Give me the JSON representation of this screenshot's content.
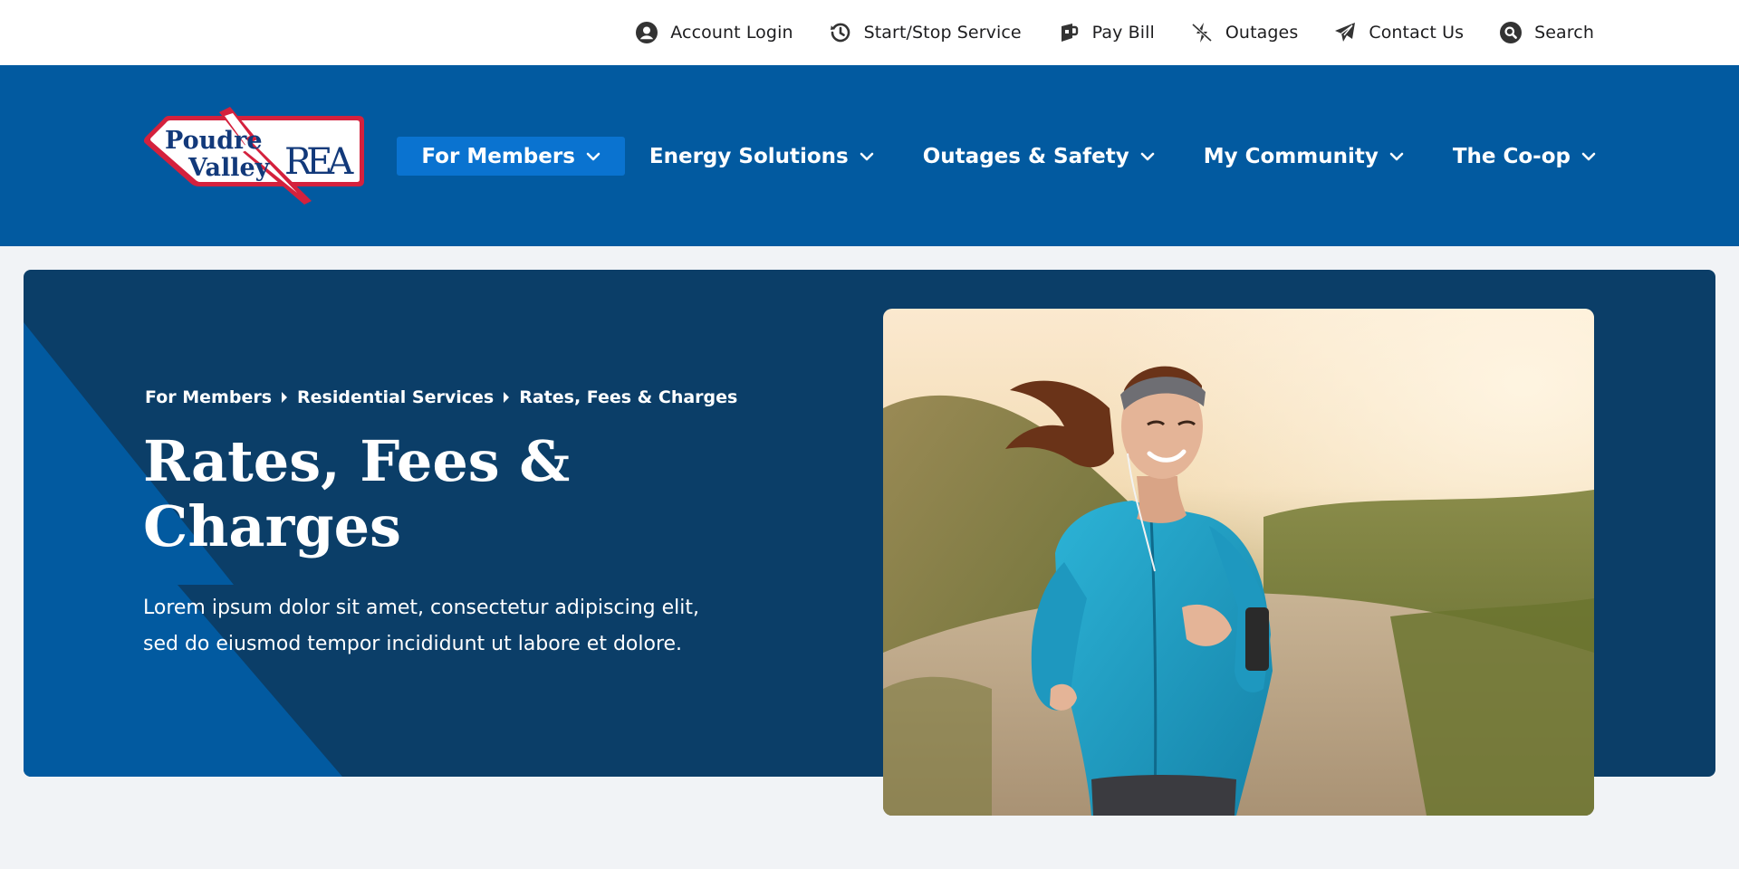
{
  "utility_bar": {
    "links": [
      {
        "label": "Account Login",
        "icon": "user-circle-icon"
      },
      {
        "label": "Start/Stop Service",
        "icon": "history-icon"
      },
      {
        "label": "Pay Bill",
        "icon": "bill-icon"
      },
      {
        "label": "Outages",
        "icon": "bolt-slash-icon"
      },
      {
        "label": "Contact Us",
        "icon": "paper-plane-icon"
      },
      {
        "label": "Search",
        "icon": "search-icon"
      }
    ]
  },
  "logo": {
    "line1": "Poudre",
    "line2": "Valley",
    "letters": "REA",
    "colors": {
      "red": "#d4213d",
      "navy": "#12397a"
    }
  },
  "primary_nav": {
    "items": [
      {
        "label": "For Members",
        "active": true
      },
      {
        "label": "Energy Solutions",
        "active": false
      },
      {
        "label": "Outages & Safety",
        "active": false
      },
      {
        "label": "My Community",
        "active": false
      },
      {
        "label": "The Co-op",
        "active": false
      }
    ]
  },
  "hero": {
    "breadcrumb": [
      "For Members",
      "Residential Services",
      "Rates, Fees & Charges"
    ],
    "title_line1": "Rates, Fees &",
    "title_line2": "Charges",
    "description_line1": "Lorem ipsum dolor sit amet, consectetur adipiscing elit,",
    "description_line2": "sed do eiusmod tempor incididunt ut labore et dolore.",
    "image": "woman-jogging-photo"
  },
  "colors": {
    "header_blue": "#025aa0",
    "active_nav": "#0a73d0",
    "hero_navy": "#0b3e68",
    "page_bg": "#f1f3f6"
  }
}
